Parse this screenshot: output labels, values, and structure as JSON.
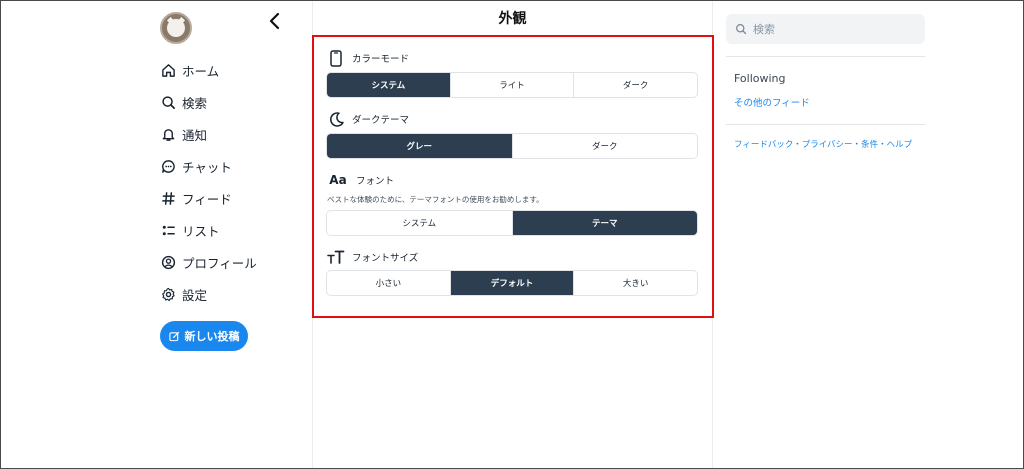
{
  "sidebar": {
    "collapse_icon": "chevron-left-icon",
    "items": [
      {
        "label": "ホーム",
        "icon": "home-icon"
      },
      {
        "label": "検索",
        "icon": "search-icon"
      },
      {
        "label": "通知",
        "icon": "bell-icon"
      },
      {
        "label": "チャット",
        "icon": "chat-icon"
      },
      {
        "label": "フィード",
        "icon": "hash-icon"
      },
      {
        "label": "リスト",
        "icon": "list-icon"
      },
      {
        "label": "プロフィール",
        "icon": "profile-icon"
      },
      {
        "label": "設定",
        "icon": "gear-icon"
      }
    ],
    "new_post": "新しい投稿"
  },
  "main": {
    "title": "外観",
    "color_mode": {
      "label": "カラーモード",
      "options": [
        "システム",
        "ライト",
        "ダーク"
      ],
      "selected": "システム"
    },
    "dark_theme": {
      "label": "ダークテーマ",
      "options": [
        "グレー",
        "ダーク"
      ],
      "selected": "グレー"
    },
    "font": {
      "label": "フォント",
      "icon_text": "Aa",
      "description": "ベストな体験のために、テーマフォントの使用をお勧めします。",
      "options": [
        "システム",
        "テーマ"
      ],
      "selected": "テーマ"
    },
    "font_size": {
      "label": "フォントサイズ",
      "options": [
        "小さい",
        "デフォルト",
        "大きい"
      ],
      "selected": "デフォルト"
    }
  },
  "right": {
    "search_placeholder": "検索",
    "feeds_title": "Following",
    "feeds_link": "その他のフィード",
    "footer": {
      "feedback": "フィードバック",
      "sep1": "・",
      "privacy": "プライバシー",
      "sep2": "・",
      "terms": "条件",
      "sep3": "・",
      "help": "ヘルプ"
    }
  },
  "colors": {
    "accent": "#1a87ee",
    "segment_active": "#2d3e50",
    "highlight_border": "#e01010"
  }
}
